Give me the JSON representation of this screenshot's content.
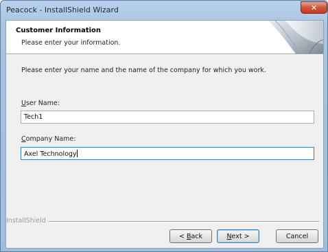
{
  "window": {
    "title": "Peacock - InstallShield Wizard",
    "close_glyph": "✕"
  },
  "header": {
    "title": "Customer Information",
    "subtitle": "Please enter your information."
  },
  "body": {
    "instruction": "Please enter your name and the name of the company for which you work.",
    "user_name": {
      "label_mnemonic": "U",
      "label_rest": "ser Name:",
      "value": "Tech1"
    },
    "company_name": {
      "label_mnemonic": "C",
      "label_rest": "ompany Name:",
      "value": "Axel Technology"
    }
  },
  "footer": {
    "brand": "InstallShield",
    "back": {
      "prefix": "< ",
      "mnemonic": "B",
      "rest": "ack"
    },
    "next": {
      "mnemonic": "N",
      "rest": "ext >"
    },
    "cancel": "Cancel"
  },
  "colors": {
    "title_bar": "#b9d1ea",
    "close_button": "#c8472f",
    "client_bg": "#f0f0f0",
    "focus_border": "#3c7fb1"
  },
  "icons": {
    "close": "close-icon",
    "header_art": "page-curl-icon"
  }
}
